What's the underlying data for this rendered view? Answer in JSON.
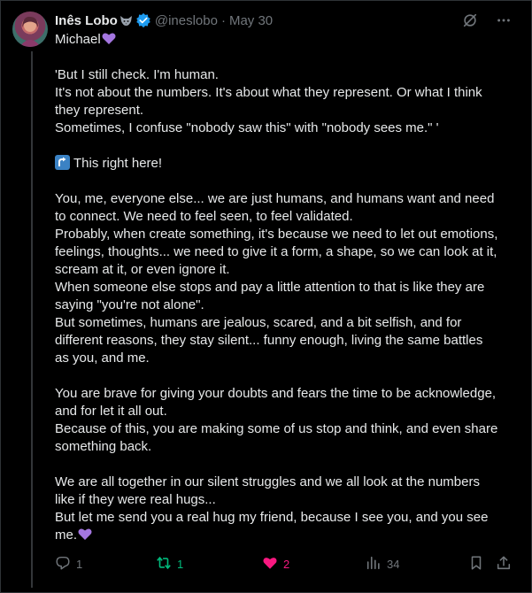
{
  "post": {
    "author_name": "Inês Lobo",
    "handle": "@ineslobo",
    "separator": "·",
    "date": "May 30",
    "lines": [
      "Michael",
      "",
      "'But I still check. I'm human.",
      "It's not about the numbers. It's about what they represent. Or what I think",
      "they represent.",
      "Sometimes, I confuse \"nobody saw this\" with \"nobody sees me.\" '",
      "",
      "This right here!",
      "",
      "You, me, everyone else... we are just humans, and humans want and need",
      "to connect. We need to feel seen, to feel validated.",
      "Probably, when create something, it's because we need to let out emotions,",
      "feelings, thoughts... we need to give it a form, a shape, so we can look at it,",
      "scream at it, or even ignore it.",
      "When someone else stops and pay a little attention to that is like they are",
      "saying \"you're not alone\".",
      "But sometimes, humans are jealous, scared, and a bit selfish, and for",
      "different reasons, they stay silent... funny enough, living the same battles",
      "as you, and me.",
      "",
      "You are brave for giving your doubts and fears the time to be acknowledge,",
      "and for let it all out.",
      "Because of this, you are making some of us stop and think, and even share",
      "something back.",
      "",
      "We are all together in our silent struggles and we all look at the numbers",
      "like if they were real hugs...",
      "But let me send you a real hug my friend, because I see you, and you see",
      "me."
    ]
  },
  "actions": {
    "replies": "1",
    "reposts": "1",
    "likes": "2",
    "views": "34"
  },
  "icons": {
    "author_emoji": "wolf-icon",
    "verified": "verified-badge-icon",
    "grok": "grok-icon",
    "more": "more-icon",
    "inline_emoji_heart": "purple-heart-icon",
    "inline_emoji_arrow": "arrow-up-right-emoji",
    "reply": "reply-icon",
    "repost": "repost-icon",
    "like": "heart-icon",
    "views": "views-icon",
    "bookmark": "bookmark-icon",
    "share": "share-icon"
  },
  "colors": {
    "background": "#000000",
    "text": "#e7e9ea",
    "secondary": "#71767b",
    "verified": "#1d9bf0",
    "repost_active": "#00ba7c",
    "like_active": "#f91880",
    "heart_emoji": "#9b6bd6"
  }
}
